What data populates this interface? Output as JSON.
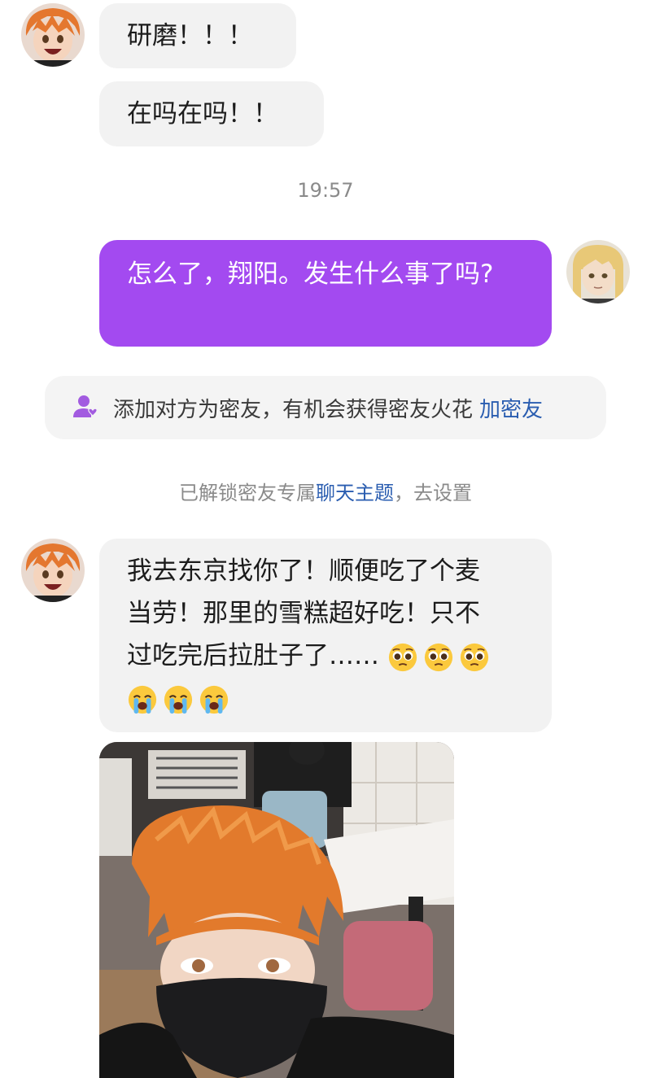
{
  "messages": [
    {
      "sender": "hinata",
      "text": "研磨！！！"
    },
    {
      "sender": "hinata",
      "text": "在吗在吗！！"
    },
    {
      "sender": "kenma",
      "text": "怎么了，翔阳。发生什么事了吗?"
    },
    {
      "sender": "hinata",
      "text_lines": [
        "我去东京找你了！顺便吃了个麦",
        "当劳！那里的雪糕超好吃！只不",
        "过吃完后拉肚子了……"
      ],
      "emojis_line3": [
        "pleading-face",
        "pleading-face",
        "pleading-face"
      ],
      "emojis_line4": [
        "loudly-crying-face",
        "loudly-crying-face",
        "loudly-crying-face"
      ]
    }
  ],
  "timestamp": "19:57",
  "notice": {
    "icon": "add-friend-icon",
    "text": "添加对方为密友，有机会获得密友火花",
    "action": "加密友",
    "accent_color": "#2a5db0"
  },
  "system_line": {
    "prefix": "已解锁密友专属",
    "link": "聊天主题",
    "suffix": "，去设置"
  },
  "photo": {
    "subject": "selfie with orange wig and black mask"
  },
  "colors": {
    "outgoing_bubble": "#a34af0",
    "incoming_bubble": "#f2f2f2"
  }
}
